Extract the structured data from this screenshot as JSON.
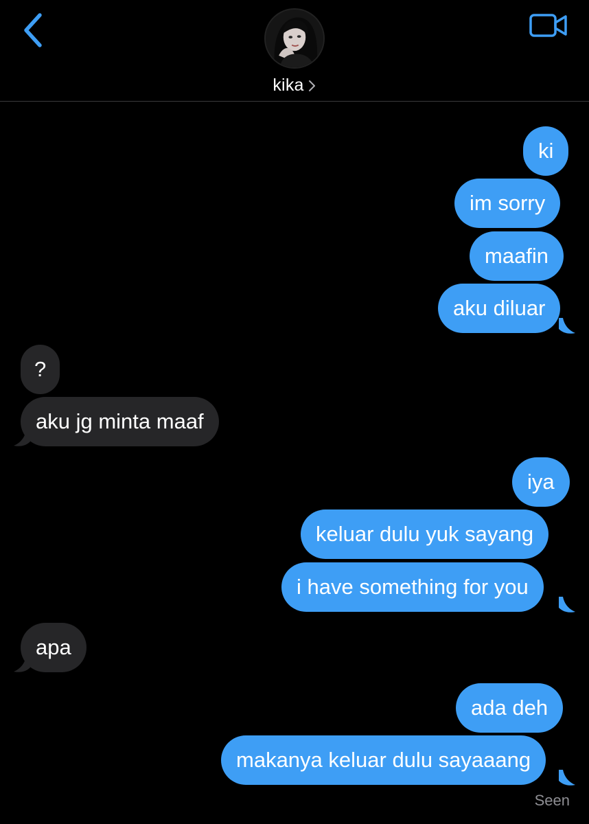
{
  "header": {
    "contact_name": "kika",
    "back_icon": "chevron-left-icon",
    "video_icon": "video-camera-icon",
    "accent_color": "#3E9EF5"
  },
  "colors": {
    "sent_bubble": "#3E9EF5",
    "received_bubble": "#262628",
    "background": "#000000",
    "seen_text": "#8E8E93"
  },
  "messages": [
    {
      "from": "me",
      "text": "ki"
    },
    {
      "from": "me",
      "text": "im sorry"
    },
    {
      "from": "me",
      "text": "maafin"
    },
    {
      "from": "me",
      "text": "aku diluar"
    },
    {
      "from": "them",
      "text": "?"
    },
    {
      "from": "them",
      "text": "aku jg minta maaf"
    },
    {
      "from": "me",
      "text": "iya"
    },
    {
      "from": "me",
      "text": "keluar dulu yuk sayang"
    },
    {
      "from": "me",
      "text": "i have something for you"
    },
    {
      "from": "them",
      "text": "apa"
    },
    {
      "from": "me",
      "text": "ada deh"
    },
    {
      "from": "me",
      "text": "makanya keluar dulu sayaaang"
    }
  ],
  "status": {
    "seen_label": "Seen"
  }
}
